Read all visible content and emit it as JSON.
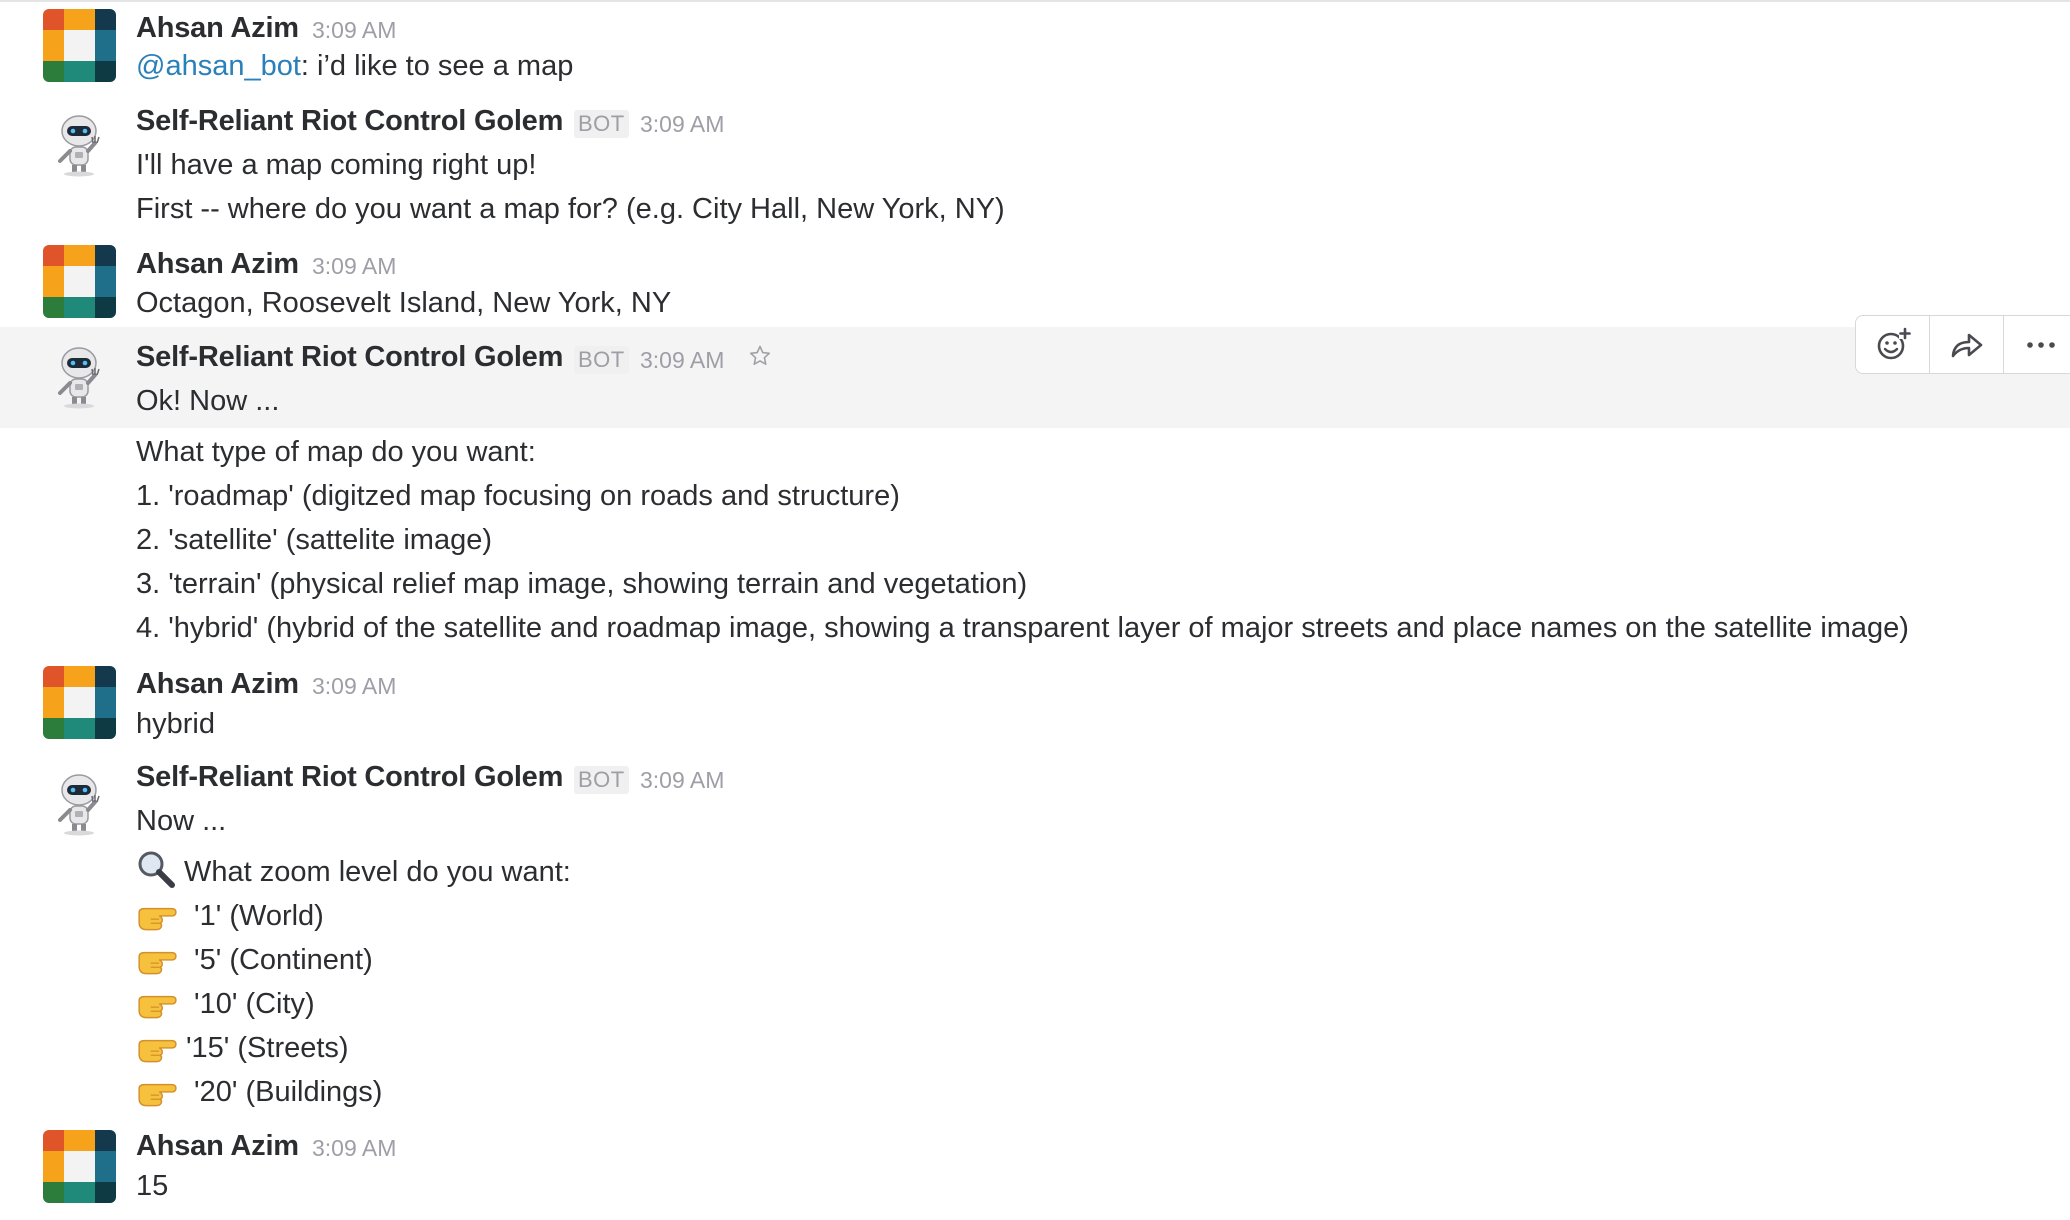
{
  "colors": {
    "mention": "#2a80b9",
    "hover_bg": "#f4f4f5",
    "text": "#2c2d30",
    "meta": "#9e9ea6"
  },
  "messages": [
    {
      "author": "Ahsan Azim",
      "time": "3:09 AM",
      "mention": "@ahsan_bot",
      "text_after_mention": ": i’d like to see a map"
    },
    {
      "author": "Self-Reliant Riot Control Golem",
      "badge": "BOT",
      "time": "3:09 AM",
      "lines": [
        "I'll have a map coming right up!",
        "First -- where do you want a map for? (e.g. City Hall, New York, NY)"
      ]
    },
    {
      "author": "Ahsan Azim",
      "time": "3:09 AM",
      "lines": [
        "Octagon, Roosevelt Island, New York, NY"
      ]
    },
    {
      "author": "Self-Reliant Riot Control Golem",
      "badge": "BOT",
      "time": "3:09 AM",
      "lines": [
        "Ok! Now ..."
      ],
      "star_icon": "star-outline-icon"
    },
    {
      "lines": [
        "What type of map do you want:",
        "1. 'roadmap' (digitzed map  focusing on roads and structure)",
        "2. 'satellite' (sattelite image)",
        "3. 'terrain' (physical relief map image, showing terrain and vegetation)",
        "4. 'hybrid' (hybrid of the satellite and roadmap image, showing a transparent layer of major streets and place names on the satellite image)"
      ]
    },
    {
      "author": "Ahsan Azim",
      "time": "3:09 AM",
      "lines": [
        "hybrid"
      ]
    },
    {
      "author": "Self-Reliant Riot Control Golem",
      "badge": "BOT",
      "time": "3:09 AM",
      "lines": [
        "Now ..."
      ]
    },
    {
      "zoom_question": "What zoom level do you want:",
      "zoom_icon": "magnifying-glass-icon",
      "options": [
        {
          "icon": "pointing-hand-icon",
          "label": " '1' (World)"
        },
        {
          "icon": "pointing-hand-icon",
          "label": " '5' (Continent)"
        },
        {
          "icon": "pointing-hand-icon",
          "label": " '10' (City)"
        },
        {
          "icon": "pointing-hand-icon",
          "label": "'15' (Streets)"
        },
        {
          "icon": "pointing-hand-icon",
          "label": " '20' (Buildings)"
        }
      ]
    },
    {
      "author": "Ahsan Azim",
      "time": "3:09 AM",
      "lines": [
        "15"
      ]
    }
  ],
  "hover_actions": [
    {
      "icon": "add-reaction-icon"
    },
    {
      "icon": "share-arrow-icon"
    },
    {
      "icon": "more-dots-icon"
    }
  ]
}
